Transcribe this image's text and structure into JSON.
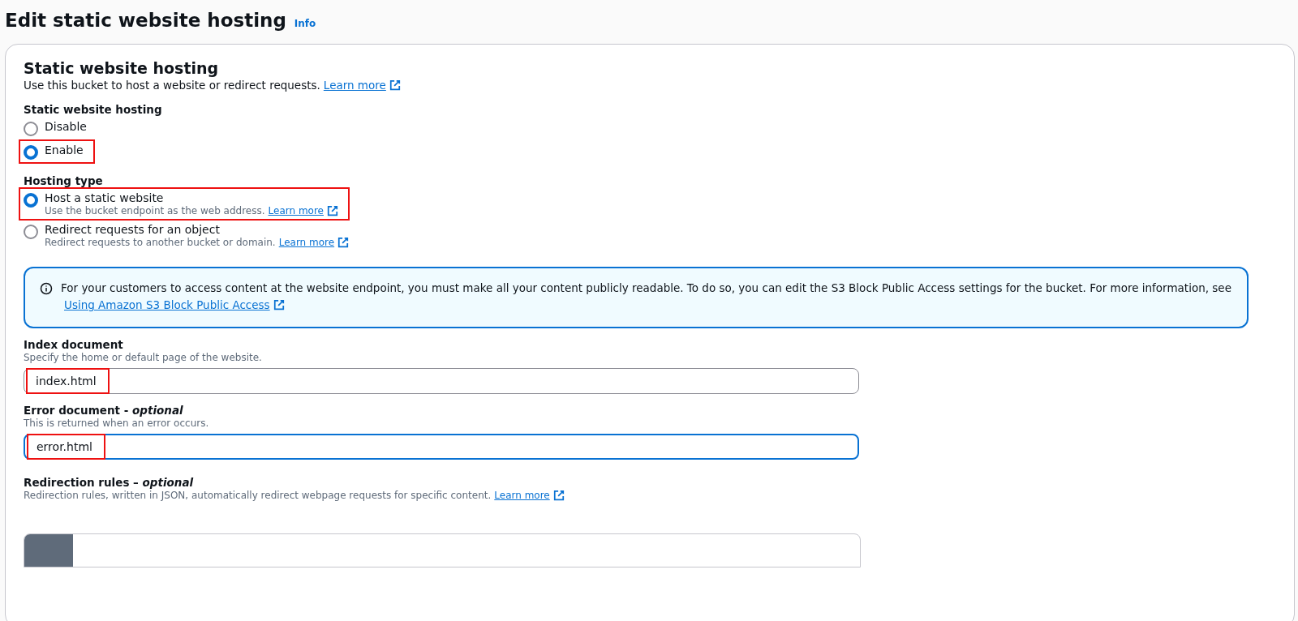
{
  "page": {
    "title": "Edit static website hosting",
    "info_link": "Info"
  },
  "section": {
    "title": "Static website hosting",
    "description": "Use this bucket to host a website or redirect requests.",
    "link": "Learn more"
  },
  "radio_groups": [
    {
      "label": "Static website hosting",
      "options": [
        {
          "label": "Disable",
          "selected": false,
          "highlighted": false
        },
        {
          "label": "Enable",
          "selected": true,
          "highlighted": true
        }
      ]
    },
    {
      "label": "Hosting type",
      "options": [
        {
          "label": "Host a static website",
          "description": "Use the bucket endpoint as the web address.",
          "link": "Learn more",
          "selected": true,
          "highlighted": true
        },
        {
          "label": "Redirect requests for an object",
          "description": "Redirect requests to another bucket or domain.",
          "link": "Learn more",
          "selected": false,
          "highlighted": false
        }
      ]
    }
  ],
  "alert": {
    "text": "For your customers to access content at the website endpoint, you must make all your content publicly readable. To do so, you can edit the S3 Block Public Access settings for the bucket. For more information, see",
    "link": "Using Amazon S3 Block Public Access"
  },
  "fields": [
    {
      "label": "Index document",
      "description": "Specify the home or default page of the website.",
      "value": "index.html",
      "focused": false,
      "highlighted": true
    },
    {
      "label": "Error document - *optional*",
      "description": "This is returned when an error occurs.",
      "value": "error.html",
      "focused": true,
      "highlighted": true
    }
  ],
  "redirection_rules": {
    "label": "Redirection rules – *optional*",
    "description": "Redirection rules, written in JSON, automatically redirect webpage requests for specific content.",
    "link": "Learn more"
  }
}
